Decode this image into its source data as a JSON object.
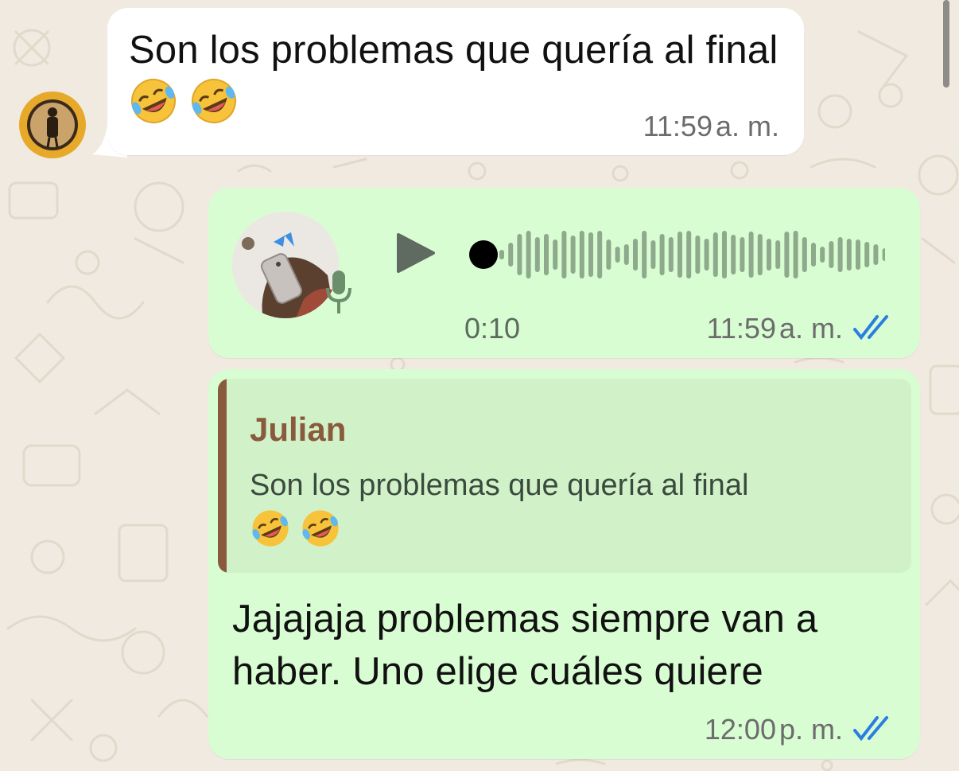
{
  "chat": {
    "incoming": {
      "text": "Son los problemas que quería al final",
      "emoji": [
        "rolling-on-floor-laughing",
        "rolling-on-floor-laughing"
      ],
      "time": "11:59",
      "ampm": "a. m."
    },
    "voice_note": {
      "duration": "0:10",
      "time": "11:59",
      "ampm": "a. m.",
      "status": "read"
    },
    "reply": {
      "quoted_author": "Julian",
      "quoted_text": "Son los problemas que quería al final",
      "quoted_emoji": [
        "rolling-on-floor-laughing",
        "rolling-on-floor-laughing"
      ],
      "text": "Jajajaja problemas siempre van a haber. Uno elige cuáles quiere",
      "time": "12:00",
      "ampm": "p. m.",
      "status": "read"
    }
  },
  "colors": {
    "chat_background": "#f0eae1",
    "incoming_bubble": "#ffffff",
    "outgoing_bubble": "#d9fdd3",
    "quote_background": "#d1f2c9",
    "quote_accent": "#8a5a3c",
    "read_ticks": "#2a7de1"
  }
}
